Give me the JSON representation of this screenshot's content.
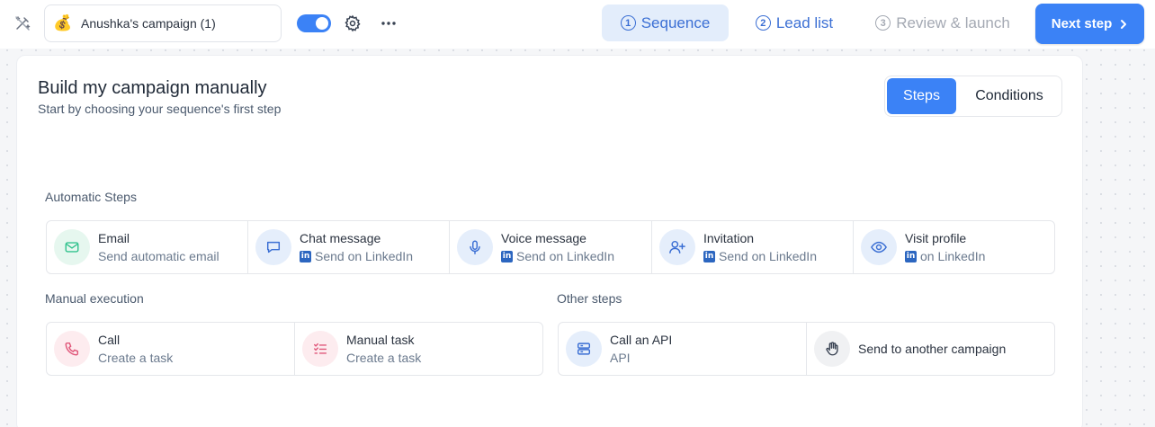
{
  "colors": {
    "accent": "#3b82f6",
    "tab_active_bg": "#e3edfb",
    "linkedin": "#2c66c0"
  },
  "header": {
    "campaign_emoji": "💰",
    "campaign_name": "Anushka's campaign (1)",
    "tabs": [
      {
        "num": "1",
        "label": "Sequence",
        "state": "active"
      },
      {
        "num": "2",
        "label": "Lead list",
        "state": "enabled"
      },
      {
        "num": "3",
        "label": "Review & launch",
        "state": "disabled"
      }
    ],
    "next_label": "Next step",
    "next_icon": "chevron-right-icon",
    "toggle_on": true
  },
  "main": {
    "title": "Build my campaign manually",
    "subtitle": "Start by choosing your sequence's first step",
    "segment": {
      "steps": "Steps",
      "conditions": "Conditions",
      "selected": "Steps"
    }
  },
  "automatic": {
    "label": "Automatic Steps",
    "items": [
      {
        "title": "Email",
        "sub": "Send automatic email",
        "icon": "mail-icon",
        "linkedin": false
      },
      {
        "title": "Chat message",
        "sub": "Send on LinkedIn",
        "icon": "chat-icon",
        "linkedin": true
      },
      {
        "title": "Voice message",
        "sub": "Send on LinkedIn",
        "icon": "microphone-icon",
        "linkedin": true
      },
      {
        "title": "Invitation",
        "sub": "Send on LinkedIn",
        "icon": "user-plus-icon",
        "linkedin": true
      },
      {
        "title": "Visit profile",
        "sub": "on LinkedIn",
        "icon": "eye-icon",
        "linkedin": true
      }
    ]
  },
  "manual": {
    "label": "Manual execution",
    "items": [
      {
        "title": "Call",
        "sub": "Create a task",
        "icon": "phone-icon"
      },
      {
        "title": "Manual task",
        "sub": "Create a task",
        "icon": "checklist-icon"
      }
    ]
  },
  "other": {
    "label": "Other steps",
    "items": [
      {
        "title": "Call an API",
        "sub": "API",
        "icon": "server-icon"
      },
      {
        "title": "Send to another campaign",
        "sub": "",
        "icon": "hand-icon"
      }
    ]
  }
}
